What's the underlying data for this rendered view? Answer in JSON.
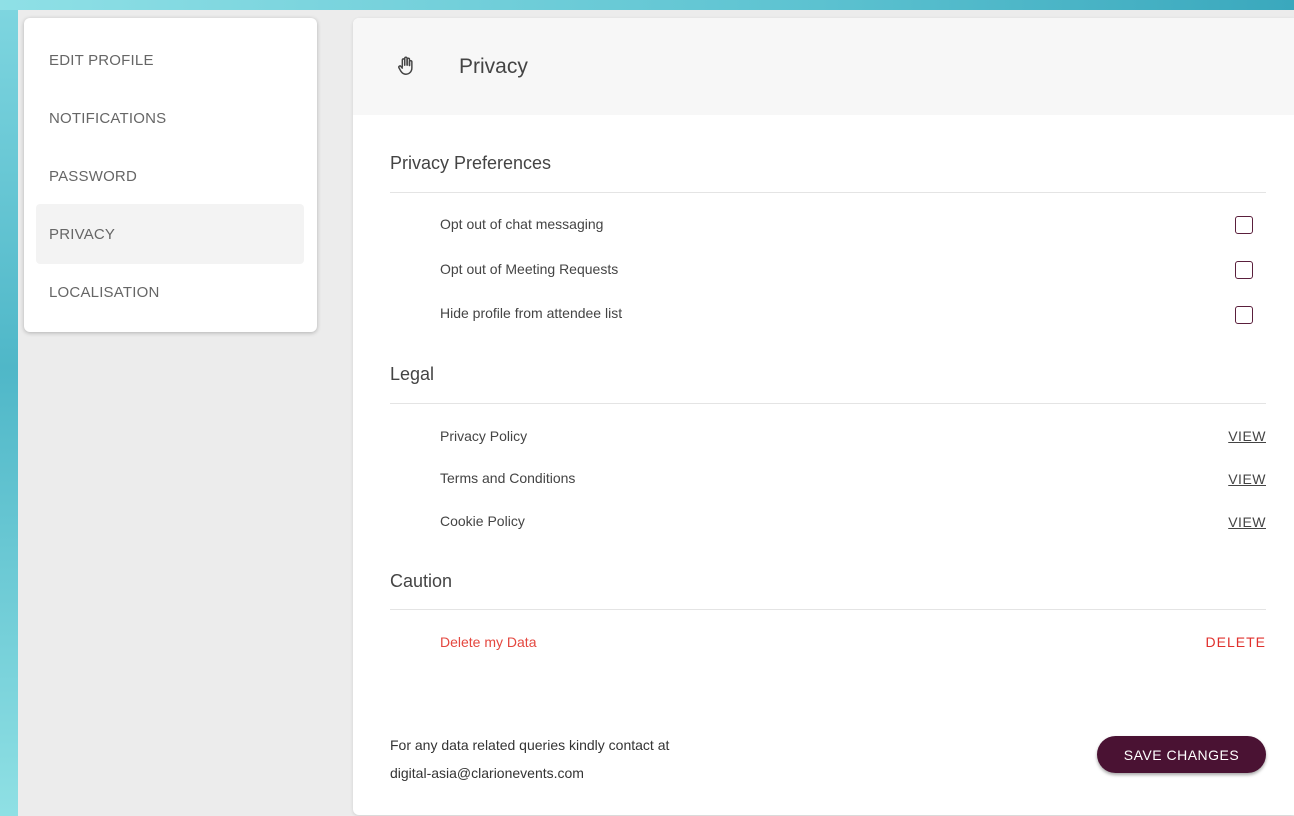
{
  "sidebar": {
    "items": [
      {
        "label": "EDIT PROFILE"
      },
      {
        "label": "NOTIFICATIONS"
      },
      {
        "label": "PASSWORD"
      },
      {
        "label": "PRIVACY",
        "active": true
      },
      {
        "label": "LOCALISATION"
      }
    ]
  },
  "header": {
    "icon": "hand-icon",
    "title": "Privacy"
  },
  "sections": {
    "preferences": {
      "title": "Privacy Preferences",
      "items": [
        {
          "label": "Opt out of chat messaging",
          "checked": false
        },
        {
          "label": "Opt out of Meeting Requests",
          "checked": false
        },
        {
          "label": "Hide profile from attendee list",
          "checked": false
        }
      ]
    },
    "legal": {
      "title": "Legal",
      "items": [
        {
          "label": "Privacy Policy",
          "action": "VIEW"
        },
        {
          "label": "Terms and Conditions",
          "action": "VIEW"
        },
        {
          "label": "Cookie Policy",
          "action": "VIEW"
        }
      ]
    },
    "caution": {
      "title": "Caution",
      "items": [
        {
          "label": "Delete my Data",
          "action": "DELETE"
        }
      ]
    }
  },
  "footer": {
    "contact_line1": "For any data related queries kindly contact at",
    "contact_line2": "digital-asia@clarionevents.com",
    "save_label": "SAVE CHANGES"
  },
  "colors": {
    "accent": "#4a1233",
    "danger": "#e4473f",
    "checkbox_border": "#5a1f3c"
  }
}
